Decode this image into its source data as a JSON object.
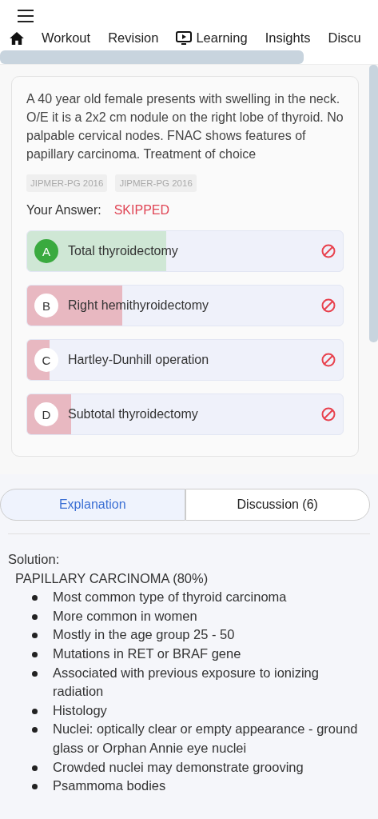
{
  "nav": {
    "tabs": [
      {
        "label": "Workout",
        "kind": "plain"
      },
      {
        "label": "Revision",
        "kind": "plain"
      },
      {
        "label": "Learning",
        "kind": "video"
      },
      {
        "label": "Insights",
        "kind": "plain"
      },
      {
        "label": "Discu",
        "kind": "plain"
      }
    ]
  },
  "question": {
    "text": "A 40 year old female presents with swelling in the neck. O/E it is a 2x2 cm nodule on the right lobe of thyroid. No palpable cervical nodes. FNAC shows features of papillary carcinoma. Treatment of choice",
    "tags": [
      "JIPMER-PG 2016",
      "JIPMER-PG 2016"
    ],
    "answer_label": "Your Answer:",
    "answer_value": "SKIPPED",
    "options": [
      {
        "letter": "A",
        "text": "Total thyroidectomy",
        "correct": true,
        "level": 0.44
      },
      {
        "letter": "B",
        "text": "Right hemithyroidectomy",
        "correct": false,
        "level": 0.3
      },
      {
        "letter": "C",
        "text": "Hartley-Dunhill operation",
        "correct": false,
        "level": 0.07
      },
      {
        "letter": "D",
        "text": "Subtotal thyroidectomy",
        "correct": false,
        "level": 0.14
      }
    ]
  },
  "tabs": [
    {
      "label": "Explanation",
      "selected": true
    },
    {
      "label": "Discussion (6)",
      "selected": false
    }
  ],
  "solution": {
    "title": "Solution:",
    "heading": "PAPILLARY CARCINOMA (80%)",
    "bullets": [
      "Most common type of thyroid carcinoma",
      "More common in women",
      "Mostly in the age group 25 - 50",
      "Mutations in RET or BRAF gene",
      "Associated with previous exposure to ionizing radiation",
      "Histology",
      "Nuclei: optically clear or empty appearance - ground glass or Orphan Annie eye nuclei",
      "Crowded nuclei may demonstrate grooving",
      "Psammoma bodies"
    ]
  }
}
